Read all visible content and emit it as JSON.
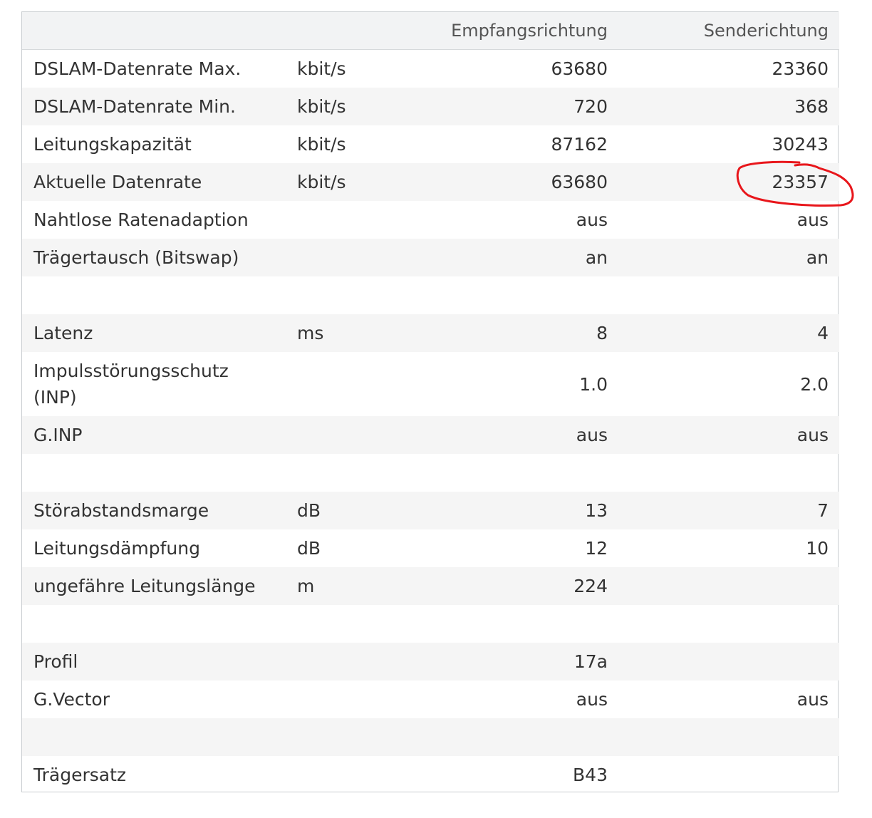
{
  "header": {
    "label": "",
    "unit": "",
    "rx": "Empfangsrichtung",
    "tx": "Senderichtung"
  },
  "rows": [
    {
      "label": "DSLAM-Datenrate Max.",
      "unit": "kbit/s",
      "rx": "63680",
      "tx": "23360"
    },
    {
      "label": "DSLAM-Datenrate Min.",
      "unit": "kbit/s",
      "rx": "720",
      "tx": "368"
    },
    {
      "label": "Leitungskapazität",
      "unit": "kbit/s",
      "rx": "87162",
      "tx": "30243"
    },
    {
      "label": "Aktuelle Datenrate",
      "unit": "kbit/s",
      "rx": "63680",
      "tx": "23357"
    },
    {
      "label": "Nahtlose Ratenadaption",
      "unit": "",
      "rx": "aus",
      "tx": "aus"
    },
    {
      "label": "Trägertausch (Bitswap)",
      "unit": "",
      "rx": "an",
      "tx": "an"
    },
    {
      "label": "",
      "unit": "",
      "rx": "",
      "tx": ""
    },
    {
      "label": "Latenz",
      "unit": "ms",
      "rx": "8",
      "tx": "4"
    },
    {
      "label": "Impulsstörungsschutz (INP)",
      "unit": "",
      "rx": "1.0",
      "tx": "2.0"
    },
    {
      "label": "G.INP",
      "unit": "",
      "rx": "aus",
      "tx": "aus"
    },
    {
      "label": "",
      "unit": "",
      "rx": "",
      "tx": ""
    },
    {
      "label": "Störabstandsmarge",
      "unit": "dB",
      "rx": "13",
      "tx": "7"
    },
    {
      "label": "Leitungsdämpfung",
      "unit": "dB",
      "rx": "12",
      "tx": "10"
    },
    {
      "label": "ungefähre Leitungslänge",
      "unit": "m",
      "rx": "224",
      "tx": ""
    },
    {
      "label": "",
      "unit": "",
      "rx": "",
      "tx": ""
    },
    {
      "label": "Profil",
      "unit": "",
      "rx": "17a",
      "tx": ""
    },
    {
      "label": "G.Vector",
      "unit": "",
      "rx": "aus",
      "tx": "aus"
    },
    {
      "label": "",
      "unit": "",
      "rx": "",
      "tx": ""
    },
    {
      "label": "Trägersatz",
      "unit": "",
      "rx": "B43",
      "tx": ""
    }
  ],
  "annotation": {
    "color": "#e8161b"
  }
}
